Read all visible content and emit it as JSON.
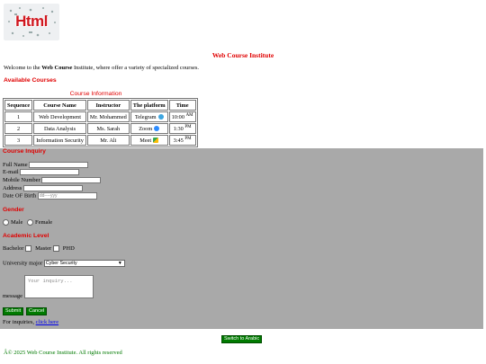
{
  "logo": {
    "text": "Html"
  },
  "site_title": "Web Course Institute",
  "welcome": {
    "prefix": "Welcome to the ",
    "bold1": "Web Course",
    "suffix": " Institute, where offer a variety of specialized courses."
  },
  "available_heading": "Available Courses",
  "table": {
    "caption": "Course Information",
    "headers": [
      "Sequence",
      "Course Name",
      "Instructor",
      "The platform",
      "Time"
    ],
    "rows": [
      {
        "seq": "1",
        "course": "Web Development",
        "instructor": "Mr. Mohammed",
        "platform": "Telegram",
        "platform_icon": "telegram-icon",
        "time": "10:00",
        "ampm": "AM"
      },
      {
        "seq": "2",
        "course": "Data Analysis",
        "instructor": "Ms. Sarah",
        "platform": "Zoom",
        "platform_icon": "zoom-icon",
        "time": "1:30",
        "ampm": "PM"
      },
      {
        "seq": "3",
        "course": "Information Security",
        "instructor": "Mr. Ali",
        "platform": "Meet",
        "platform_icon": "meet-icon",
        "time": "3:45",
        "ampm": "PM"
      }
    ]
  },
  "form": {
    "heading": "Course Inquiry",
    "full_name": "Full Name",
    "email": "E-mail",
    "mobile": "Mobile Number",
    "address": "Address",
    "dob": "Date OF Birth",
    "dob_placeholder": "dd----yyy",
    "gender_heading": "Gender",
    "male": "Male",
    "female": "Female",
    "academic_heading": "Academic Level",
    "bachelor": "Bachelor",
    "master": "Master",
    "phd": "PHD",
    "major_label": "University major",
    "major_selected": "Cyber Security",
    "message_label": "message",
    "message_placeholder": "Your inquiry...",
    "submit": "Submit",
    "cancel": "Cancel",
    "inquiries_prefix": "For inquiries, ",
    "inquiries_link": "click here"
  },
  "switch_button": "Switch to Arabic",
  "footer": "Â© 2025 Web Course Institute. All rights reserved",
  "colors": {
    "heading_red": "#e00000",
    "form_bg": "#a9a9a9",
    "button_green": "#007a00"
  }
}
